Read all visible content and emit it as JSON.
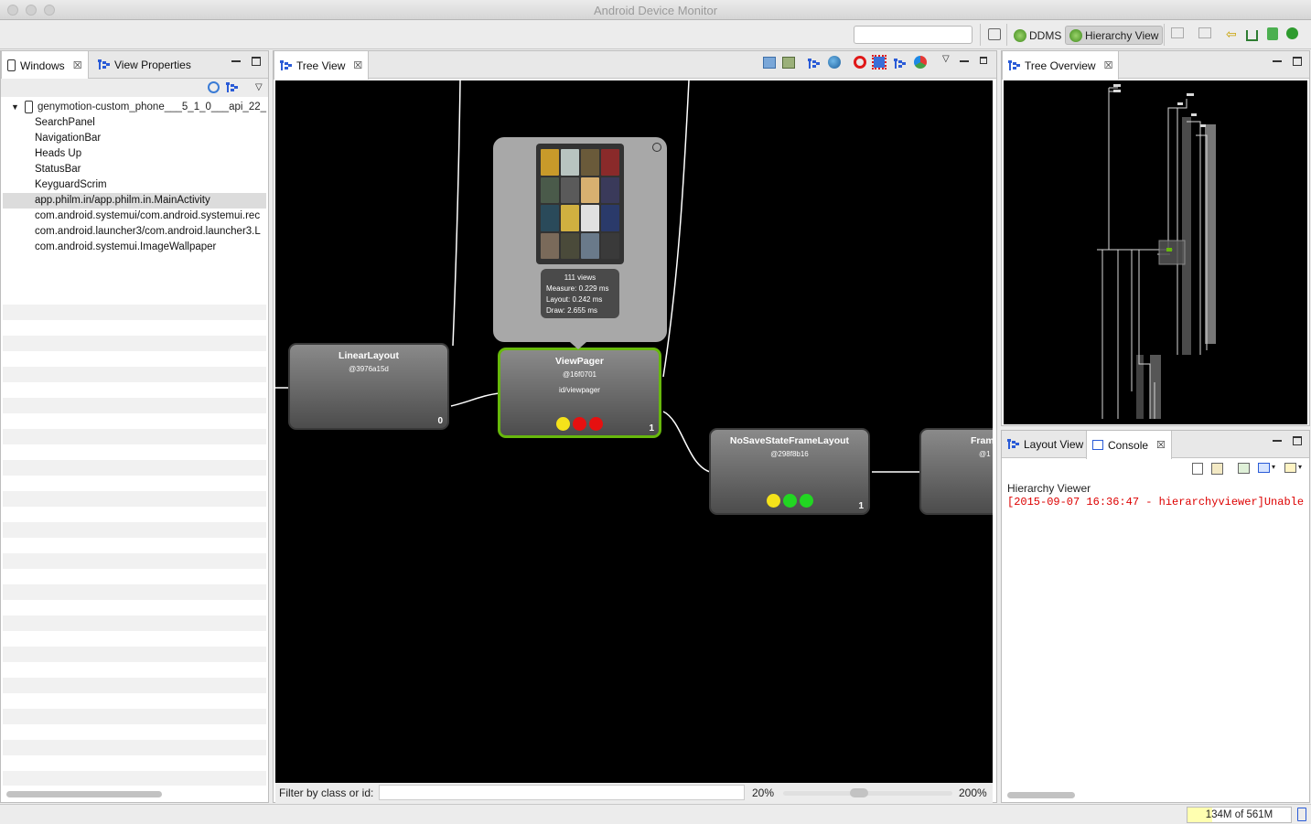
{
  "window": {
    "title": "Android Device Monitor"
  },
  "toolbar": {
    "search_value": "",
    "perspectives": [
      {
        "label": "DDMS",
        "icon": "ddms-icon",
        "active": false
      },
      {
        "label": "Hierarchy View",
        "icon": "hierarchy-view-icon",
        "active": true
      }
    ]
  },
  "windows_panel": {
    "tabs": [
      {
        "label": "Windows",
        "icon": "device-icon"
      },
      {
        "label": "View Properties",
        "icon": "tree-icon"
      }
    ],
    "device": "genymotion-custom_phone___5_1_0___api_22_",
    "items": [
      "SearchPanel",
      "NavigationBar",
      "Heads Up",
      "StatusBar",
      "KeyguardScrim",
      "app.philm.in/app.philm.in.MainActivity",
      "com.android.systemui/com.android.systemui.rec",
      "com.android.launcher3/com.android.launcher3.L",
      "com.android.systemui.ImageWallpaper"
    ],
    "selected_index": 5
  },
  "tree_view": {
    "tab_label": "Tree View",
    "nodes": [
      {
        "name": "LinearLayout",
        "hash": "@3976a15d",
        "id": "",
        "index": "0",
        "dots": []
      },
      {
        "name": "ViewPager",
        "hash": "@16f0701",
        "id": "id/viewpager",
        "index": "1",
        "dots": [
          "#f5e21a",
          "#e61010",
          "#e61010"
        ]
      },
      {
        "name": "NoSaveStateFrameLayout",
        "hash": "@298f8b16",
        "id": "",
        "index": "1",
        "dots": [
          "#f5e21a",
          "#22d622",
          "#22d622"
        ]
      },
      {
        "name": "Fram",
        "hash": "@1",
        "id": "",
        "index": "",
        "dots": []
      }
    ],
    "popup": {
      "views": "111 views",
      "measure": "Measure: 0.229 ms",
      "layout": "Layout: 0.242 ms",
      "draw": "Draw: 2.655 ms"
    },
    "filter_label": "Filter by class or id:",
    "filter_value": "",
    "zoom_min": "20%",
    "zoom_max": "200%"
  },
  "tree_overview": {
    "tab_label": "Tree Overview"
  },
  "console_panel": {
    "tabs": [
      {
        "label": "Layout View"
      },
      {
        "label": "Console"
      }
    ],
    "title": "Hierarchy Viewer",
    "line": "[2015-09-07 16:36:47 - hierarchyviewer]Unable"
  },
  "status": {
    "memory": "134M of 561M",
    "memory_used_fraction": 0.239
  },
  "colors": {
    "selection_border": "#67b80c",
    "console_error": "#dd0000",
    "tree_icon": "#2a5bd7"
  }
}
